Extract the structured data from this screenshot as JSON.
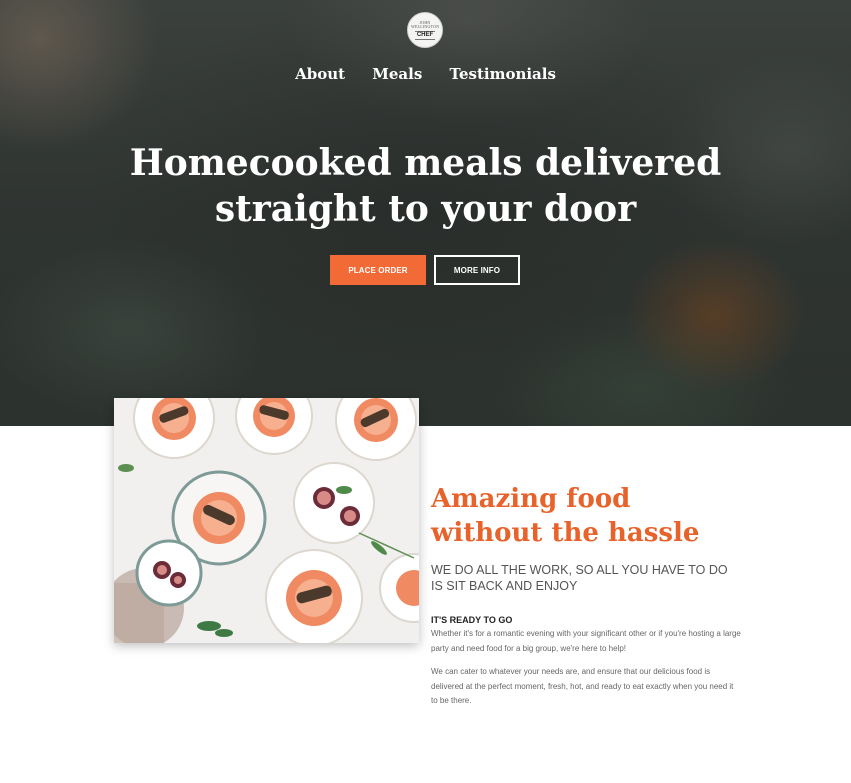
{
  "logo": {
    "top_text": "JOHN WELLINGTON",
    "main_text": "CHEF"
  },
  "nav": {
    "items": [
      {
        "label": "About"
      },
      {
        "label": "Meals"
      },
      {
        "label": "Testimonials"
      }
    ]
  },
  "hero": {
    "title_line1": "Homecooked meals delivered",
    "title_line2": "straight to your door",
    "primary_button": "PLACE ORDER",
    "secondary_button": "MORE INFO"
  },
  "feature": {
    "title_line1": "Amazing food",
    "title_line2": "without the hassle",
    "subtitle": "WE DO ALL THE WORK, SO ALL YOU HAVE TO DO IS SIT BACK AND ENJOY",
    "subheading": "IT'S READY TO GO",
    "paragraph1": "Whether it's for a romantic evening with your significant other or if you're hosting a large party and need food for a big group, we're here to help!",
    "paragraph2": "We can cater to whatever your needs are, and ensure that our delicious food is delivered at the perfect moment, fresh, hot, and ready to eat exactly when you need it to be there."
  },
  "colors": {
    "accent": "#f26a35",
    "title_orange": "#e8622b",
    "hero_bg": "#2f3431"
  }
}
